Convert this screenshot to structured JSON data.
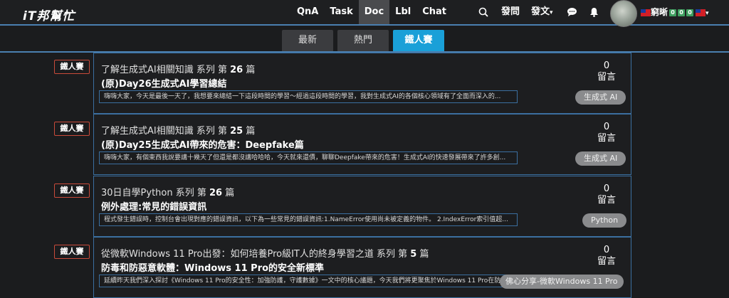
{
  "header": {
    "logo": "iT邦幫忙",
    "nav": [
      "QnA",
      "Task",
      "Doc",
      "Lbl",
      "Chat"
    ],
    "active_nav": "Doc",
    "ask": "發問",
    "post_article": "發文",
    "post_article_suffix": "▾",
    "username": "窮晰",
    "user_badges": [
      "0",
      "0",
      "0"
    ],
    "user_menu_suffix": "▾"
  },
  "tabs": {
    "items": [
      "最新",
      "熱門",
      "鐵人賽"
    ],
    "active": "鐵人賽"
  },
  "posts": [
    {
      "badge": "鐵人賽",
      "series_prefix": "了解生成式AI相關知識 系列 第",
      "series_num": "26",
      "series_suffix": "篇",
      "title": "(原)Day26生成式AI學習總結",
      "excerpt": "嗨嗨大家，今天是最後一天了，我想要來總結一下這段時間的學習～經過這段時間的學習，我對生成式AI的各個核心領域有了全面而深入的...",
      "count": "0",
      "count_label": "留言",
      "tag": "生成式 AI"
    },
    {
      "badge": "鐵人賽",
      "series_prefix": "了解生成式AI相關知識 系列 第",
      "series_num": "25",
      "series_suffix": "篇",
      "title": "(原)Day25生成式AI帶來的危害：Deepfake篇",
      "excerpt": "嗨嗨大家，有個東西我說要講十幾天了但還是都沒講哈哈哈，今天就來還債，聊聊Deepfake帶來的危害！生成式AI的快速發展帶來了許多創...",
      "count": "0",
      "count_label": "留言",
      "tag": "生成式 AI"
    },
    {
      "badge": "鐵人賽",
      "series_prefix": "30日自學Python 系列 第",
      "series_num": "26",
      "series_suffix": "篇",
      "title": "例外處理:常見的錯誤資訊",
      "excerpt": "程式發生錯誤時，控制台會出現對應的錯誤資訊，以下為一些常見的錯誤資訊:1.NameError使用尚未被定義的物件。 2.IndexError索引值超...",
      "count": "0",
      "count_label": "留言",
      "tag": "Python"
    },
    {
      "badge": "鐵人賽",
      "series_prefix": "從微軟Windows 11 Pro出發：如何培養Pro級IT人的終身學習之道 系列 第",
      "series_num": "5",
      "series_suffix": "篇",
      "title": "防毒和防惡意軟體：Windows 11 Pro的安全新標準",
      "excerpt": "延續昨天我們深入探討《Windows 11 Pro的安全性：加強防護，守護數據》一文中的核心議題，今天我們將更聚焦於Windows 11 Pro在防...",
      "count": "0",
      "count_label": "留言",
      "tag": "佛心分享-微軟Windows 11 Pro"
    }
  ]
}
